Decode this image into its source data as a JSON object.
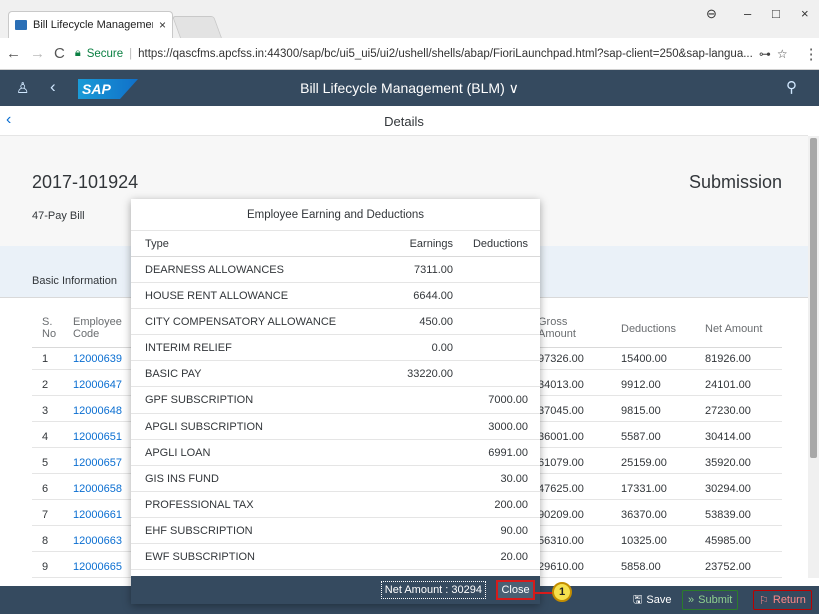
{
  "browser": {
    "tab_title": "Bill Lifecycle Managemen",
    "tab_close": "×",
    "secure_label": "Secure",
    "url": "https://qascfms.apcfss.in:44300/sap/bc/ui5_ui5/ui2/ushell/shells/abap/FioriLaunchpad.html?sap-client=250&sap-langua...",
    "window_controls": [
      "–",
      "□",
      "×"
    ]
  },
  "shell": {
    "logo": "SAP",
    "title": "Bill Lifecycle Management (BLM) ∨"
  },
  "subheader": {
    "title": "Details"
  },
  "object_header": {
    "id": "2017-101924",
    "subtitle": "47-Pay Bill",
    "status": "Submission"
  },
  "section": {
    "basic_info": "Basic Information"
  },
  "background_table": {
    "headers": {
      "sno": "S. No",
      "code": "Employee Code",
      "gross": "Gross Amount",
      "deductions": "Deductions",
      "net": "Net Amount"
    },
    "rows": [
      {
        "no": "1",
        "code": "12000639",
        "gross": "97326.00",
        "ded": "15400.00",
        "net": "81926.00"
      },
      {
        "no": "2",
        "code": "12000647",
        "gross": "34013.00",
        "ded": "9912.00",
        "net": "24101.00"
      },
      {
        "no": "3",
        "code": "12000648",
        "gross": "37045.00",
        "ded": "9815.00",
        "net": "27230.00"
      },
      {
        "no": "4",
        "code": "12000651",
        "gross": "36001.00",
        "ded": "5587.00",
        "net": "30414.00"
      },
      {
        "no": "5",
        "code": "12000657",
        "gross": "61079.00",
        "ded": "25159.00",
        "net": "35920.00"
      },
      {
        "no": "6",
        "code": "12000658",
        "gross": "47625.00",
        "ded": "17331.00",
        "net": "30294.00"
      },
      {
        "no": "7",
        "code": "12000661",
        "gross": "90209.00",
        "ded": "36370.00",
        "net": "53839.00"
      },
      {
        "no": "8",
        "code": "12000663",
        "gross": "56310.00",
        "ded": "10325.00",
        "net": "45985.00"
      },
      {
        "no": "9",
        "code": "12000665",
        "gross": "29610.00",
        "ded": "5858.00",
        "net": "23752.00"
      }
    ]
  },
  "dialog": {
    "title": "Employee Earning and Deductions",
    "headers": {
      "type": "Type",
      "earnings": "Earnings",
      "deductions": "Deductions"
    },
    "rows": [
      {
        "type": "DEARNESS ALLOWANCES",
        "earnings": "7311.00",
        "deductions": ""
      },
      {
        "type": "HOUSE RENT ALLOWANCE",
        "earnings": "6644.00",
        "deductions": ""
      },
      {
        "type": "CITY COMPENSATORY ALLOWANCE",
        "earnings": "450.00",
        "deductions": ""
      },
      {
        "type": "INTERIM RELIEF",
        "earnings": "0.00",
        "deductions": ""
      },
      {
        "type": "BASIC PAY",
        "earnings": "33220.00",
        "deductions": ""
      },
      {
        "type": "GPF SUBSCRIPTION",
        "earnings": "",
        "deductions": "7000.00"
      },
      {
        "type": "APGLI SUBSCRIPTION",
        "earnings": "",
        "deductions": "3000.00"
      },
      {
        "type": "APGLI LOAN",
        "earnings": "",
        "deductions": "6991.00"
      },
      {
        "type": "GIS INS FUND",
        "earnings": "",
        "deductions": "30.00"
      },
      {
        "type": "PROFESSIONAL TAX",
        "earnings": "",
        "deductions": "200.00"
      },
      {
        "type": "EHF SUBSCRIPTION",
        "earnings": "",
        "deductions": "90.00"
      },
      {
        "type": "EWF SUBSCRIPTION",
        "earnings": "",
        "deductions": "20.00"
      }
    ],
    "net_amount": "Net Amount : 30294",
    "close_label": "Close"
  },
  "footer": {
    "save_label": "Save",
    "submit_label": "Submit",
    "return_label": "Return"
  },
  "callout_number": "1"
}
